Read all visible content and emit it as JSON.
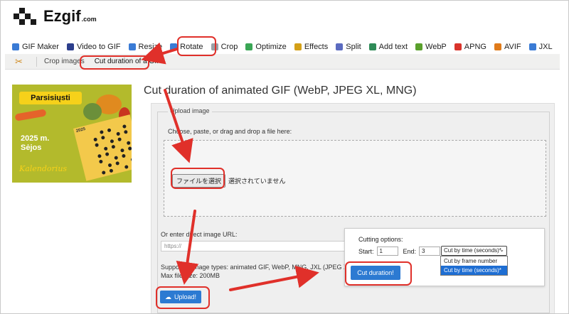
{
  "brand": {
    "name": "Ezgif",
    "suffix": ".com"
  },
  "nav": [
    {
      "label": "GIF Maker",
      "icon": "gif-maker-icon",
      "color": "#3a7bd5"
    },
    {
      "label": "Video to GIF",
      "icon": "video-icon",
      "color": "#2c3e8c"
    },
    {
      "label": "Resize",
      "icon": "resize-icon",
      "color": "#3a7bd5"
    },
    {
      "label": "Rotate",
      "icon": "rotate-icon",
      "color": "#3a7bd5"
    },
    {
      "label": "Crop",
      "icon": "crop-icon",
      "color": "#9aa0a6"
    },
    {
      "label": "Optimize",
      "icon": "optimize-icon",
      "color": "#3aa655"
    },
    {
      "label": "Effects",
      "icon": "effects-icon",
      "color": "#d4a017"
    },
    {
      "label": "Split",
      "icon": "split-icon",
      "color": "#5b6bc0"
    },
    {
      "label": "Add text",
      "icon": "add-text-icon",
      "color": "#2e8b57"
    },
    {
      "label": "WebP",
      "icon": "webp-icon",
      "color": "#5aa02c"
    },
    {
      "label": "APNG",
      "icon": "apng-icon",
      "color": "#d9342b"
    },
    {
      "label": "AVIF",
      "icon": "avif-icon",
      "color": "#e07b1a"
    },
    {
      "label": "JXL",
      "icon": "jxl-icon",
      "color": "#3a7bd5"
    }
  ],
  "subnav": {
    "items": [
      "Crop images",
      "Cut duration of a GIF"
    ],
    "icon": "scissors-icon"
  },
  "ad": {
    "banner": "Parsisiųsti",
    "year": "2025 m.",
    "subtitle": "Sėjos",
    "script": "Kalendorius",
    "grid_header": "2025"
  },
  "page_title": "Cut duration of animated GIF (WebP, JPEG XL, MNG)",
  "upload": {
    "legend": "Upload image",
    "drop_label": "Choose, paste, or drag and drop a file here:",
    "file_button": "ファイルを選択",
    "file_status": "選択されていません",
    "url_label": "Or enter direct image URL:",
    "url_placeholder": "https://",
    "supported": "Supported image types: animated GIF, WebP, MNG, JXL (JPEG XL)",
    "max_size": "Max file size: 200MB",
    "upload_button": "Upload!"
  },
  "cutting": {
    "title": "Cutting options:",
    "start_label": "Start:",
    "start_value": "1",
    "end_label": "End:",
    "end_value": "3",
    "selected": "Cut by time (seconds)*",
    "options": [
      "Cut by frame number",
      "Cut by time (seconds)*"
    ],
    "button": "Cut duration!"
  },
  "colors": {
    "accent": "#2c7ad2",
    "annotation": "#e0302a",
    "ad_bg": "#b3ba2c",
    "ad_banner": "#f6d11a"
  }
}
